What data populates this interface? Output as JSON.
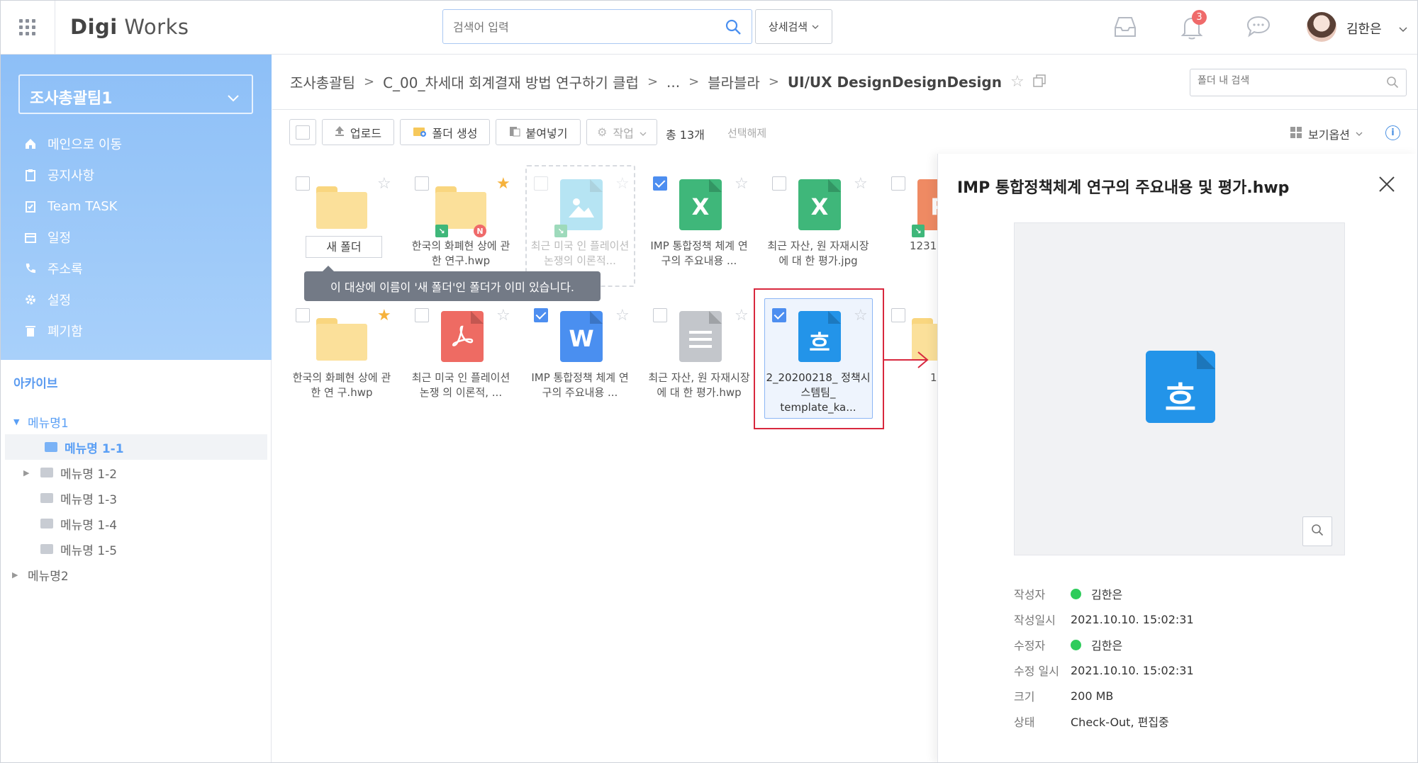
{
  "app": {
    "logo_bold": "Digi",
    "logo_rest": " Works"
  },
  "header": {
    "search_placeholder": "검색어 입력",
    "advanced_search": "상세검색",
    "notification_count": "3",
    "user_name": "김한은"
  },
  "sidebar": {
    "team": "조사총괄팀1",
    "menu": [
      {
        "label": "메인으로 이동",
        "icon": "home-icon"
      },
      {
        "label": "공지사항",
        "icon": "clipboard-icon"
      },
      {
        "label": "Team TASK",
        "icon": "task-icon"
      },
      {
        "label": "일정",
        "icon": "calendar-icon"
      },
      {
        "label": "주소록",
        "icon": "phone-icon"
      },
      {
        "label": "설정",
        "icon": "gear-icon"
      },
      {
        "label": "폐기함",
        "icon": "trash-icon"
      }
    ],
    "archive_title": "아카이브",
    "tree": [
      {
        "label": "메뉴명1"
      },
      {
        "label": "메뉴명 1-1"
      },
      {
        "label": "메뉴명 1-2"
      },
      {
        "label": "메뉴명 1-3"
      },
      {
        "label": "메뉴명 1-4"
      },
      {
        "label": "메뉴명 1-5"
      },
      {
        "label": "메뉴명2"
      }
    ]
  },
  "breadcrumb": [
    "조사총괄팀",
    "C_00_차세대 회계결재 방법 연구하기 클럽",
    "...",
    "블라블라",
    "UI/UX DesignDesignDesign"
  ],
  "folder_search_placeholder": "폴더 내 검색",
  "toolbar": {
    "upload": "업로드",
    "new_folder": "폴더 생성",
    "paste": "붙여넣기",
    "action": "작업",
    "total": "총 13개",
    "deselect": "선택해제",
    "view_options": "보기옵션"
  },
  "files": [
    {
      "name": "새 폴더",
      "type": "folder"
    },
    {
      "name": "한국의 화폐현 상에 관한 연구.hwp",
      "type": "folder"
    },
    {
      "name": "최근 미국 인 플레이션 논쟁의 이론적...",
      "type": "image"
    },
    {
      "name": "IMP 통합정책 체계 연구의 주요내용 ...",
      "type": "excel"
    },
    {
      "name": "최근 자산, 원 자재시장에 대 한 평가.jpg",
      "type": "excel"
    },
    {
      "name": "1231",
      "type": "ppt"
    },
    {
      "name": "한국의 화폐현 상에 관한 연 구.hwp",
      "type": "folder"
    },
    {
      "name": "최근 미국 인 플레이션 논쟁 의 이론적, ...",
      "type": "pdf"
    },
    {
      "name": "IMP 통합정책 체계 연구의 주요내용 ...",
      "type": "word"
    },
    {
      "name": "최근 자산, 원 자재시장에 대 한 평가.hwp",
      "type": "text"
    },
    {
      "name": "2_20200218_ 정책시스템팀_ template_ka...",
      "type": "hwp"
    },
    {
      "name": "1",
      "type": "folder"
    }
  ],
  "tooltip": "이 대상에 이름이 '새 폴더'인 폴더가 이미 있습니다.",
  "panel": {
    "title": "IMP 통합정책체계 연구의 주요내용 및 평가.hwp",
    "meta": [
      {
        "key": "작성자",
        "value": "김한은",
        "online": true
      },
      {
        "key": "작성일시",
        "value": "2021.10.10. 15:02:31"
      },
      {
        "key": "수정자",
        "value": "김한은",
        "online": true
      },
      {
        "key": "수정 일시",
        "value": "2021.10.10. 15:02:31"
      },
      {
        "key": "크기",
        "value": "200 MB"
      },
      {
        "key": "상태",
        "value": "Check-Out, 편집중"
      }
    ]
  },
  "colors": {
    "accent": "#4d8ef0",
    "sidebar": "#98c7f8",
    "excel": "#3fb77a",
    "pdf": "#ee6b63",
    "word": "#4a8ff0",
    "hwp": "#2394e9",
    "highlight": "#d8283e"
  }
}
